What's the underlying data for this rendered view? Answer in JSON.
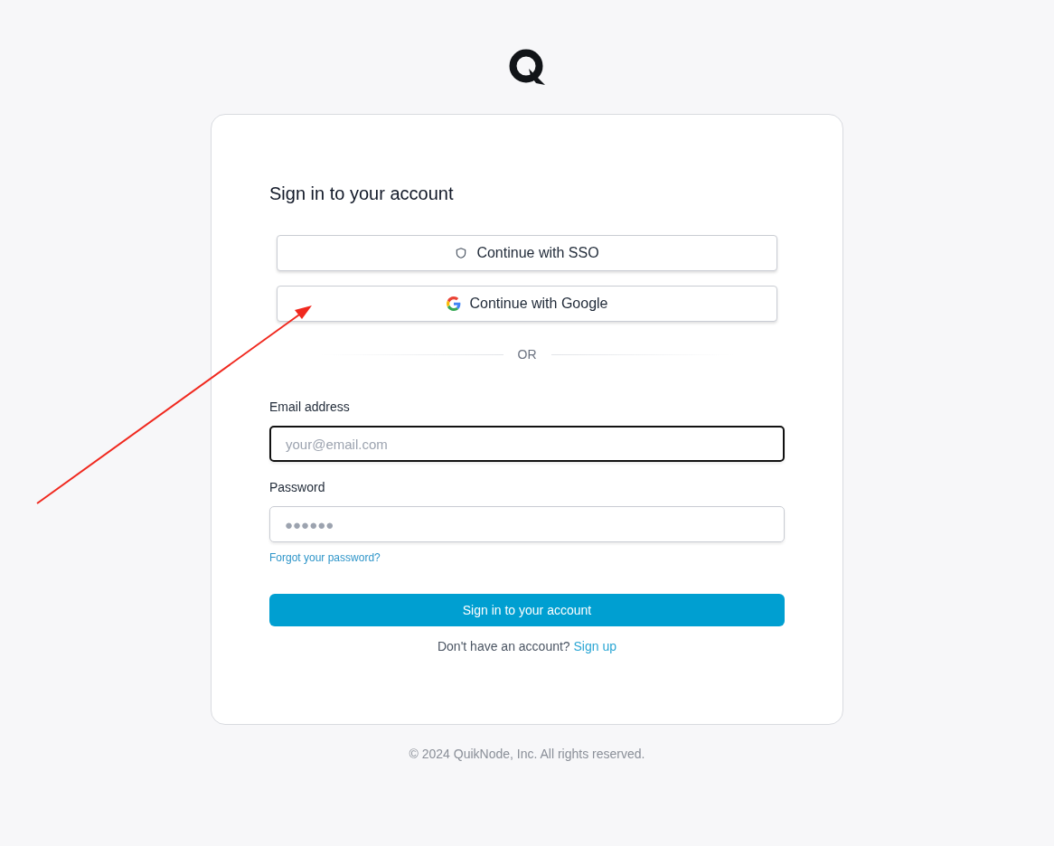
{
  "card": {
    "title": "Sign in to your account",
    "providers": [
      {
        "kind": "sso",
        "label": "Continue with SSO"
      },
      {
        "kind": "google",
        "label": "Continue with Google"
      }
    ],
    "divider": "OR",
    "fields": [
      {
        "label": "Email address",
        "placeholder": "your@email.com",
        "focused": true
      },
      {
        "label": "Password",
        "placeholder": "●●●●●●",
        "focused": false
      }
    ],
    "forgot_link": "Forgot your password?",
    "submit": "Sign in to your account",
    "signup": {
      "prompt": "Don't have an account?",
      "link": "Sign up"
    }
  },
  "footer": "© 2024 QuikNode, Inc. All rights reserved."
}
